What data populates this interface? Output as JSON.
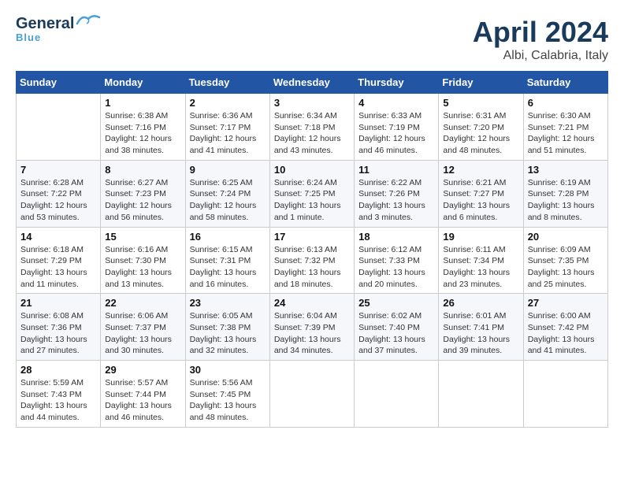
{
  "header": {
    "logo_general": "General",
    "logo_blue": "Blue",
    "month": "April 2024",
    "location": "Albi, Calabria, Italy"
  },
  "days_of_week": [
    "Sunday",
    "Monday",
    "Tuesday",
    "Wednesday",
    "Thursday",
    "Friday",
    "Saturday"
  ],
  "weeks": [
    [
      {
        "day": "",
        "info": ""
      },
      {
        "day": "1",
        "info": "Sunrise: 6:38 AM\nSunset: 7:16 PM\nDaylight: 12 hours\nand 38 minutes."
      },
      {
        "day": "2",
        "info": "Sunrise: 6:36 AM\nSunset: 7:17 PM\nDaylight: 12 hours\nand 41 minutes."
      },
      {
        "day": "3",
        "info": "Sunrise: 6:34 AM\nSunset: 7:18 PM\nDaylight: 12 hours\nand 43 minutes."
      },
      {
        "day": "4",
        "info": "Sunrise: 6:33 AM\nSunset: 7:19 PM\nDaylight: 12 hours\nand 46 minutes."
      },
      {
        "day": "5",
        "info": "Sunrise: 6:31 AM\nSunset: 7:20 PM\nDaylight: 12 hours\nand 48 minutes."
      },
      {
        "day": "6",
        "info": "Sunrise: 6:30 AM\nSunset: 7:21 PM\nDaylight: 12 hours\nand 51 minutes."
      }
    ],
    [
      {
        "day": "7",
        "info": "Sunrise: 6:28 AM\nSunset: 7:22 PM\nDaylight: 12 hours\nand 53 minutes."
      },
      {
        "day": "8",
        "info": "Sunrise: 6:27 AM\nSunset: 7:23 PM\nDaylight: 12 hours\nand 56 minutes."
      },
      {
        "day": "9",
        "info": "Sunrise: 6:25 AM\nSunset: 7:24 PM\nDaylight: 12 hours\nand 58 minutes."
      },
      {
        "day": "10",
        "info": "Sunrise: 6:24 AM\nSunset: 7:25 PM\nDaylight: 13 hours\nand 1 minute."
      },
      {
        "day": "11",
        "info": "Sunrise: 6:22 AM\nSunset: 7:26 PM\nDaylight: 13 hours\nand 3 minutes."
      },
      {
        "day": "12",
        "info": "Sunrise: 6:21 AM\nSunset: 7:27 PM\nDaylight: 13 hours\nand 6 minutes."
      },
      {
        "day": "13",
        "info": "Sunrise: 6:19 AM\nSunset: 7:28 PM\nDaylight: 13 hours\nand 8 minutes."
      }
    ],
    [
      {
        "day": "14",
        "info": "Sunrise: 6:18 AM\nSunset: 7:29 PM\nDaylight: 13 hours\nand 11 minutes."
      },
      {
        "day": "15",
        "info": "Sunrise: 6:16 AM\nSunset: 7:30 PM\nDaylight: 13 hours\nand 13 minutes."
      },
      {
        "day": "16",
        "info": "Sunrise: 6:15 AM\nSunset: 7:31 PM\nDaylight: 13 hours\nand 16 minutes."
      },
      {
        "day": "17",
        "info": "Sunrise: 6:13 AM\nSunset: 7:32 PM\nDaylight: 13 hours\nand 18 minutes."
      },
      {
        "day": "18",
        "info": "Sunrise: 6:12 AM\nSunset: 7:33 PM\nDaylight: 13 hours\nand 20 minutes."
      },
      {
        "day": "19",
        "info": "Sunrise: 6:11 AM\nSunset: 7:34 PM\nDaylight: 13 hours\nand 23 minutes."
      },
      {
        "day": "20",
        "info": "Sunrise: 6:09 AM\nSunset: 7:35 PM\nDaylight: 13 hours\nand 25 minutes."
      }
    ],
    [
      {
        "day": "21",
        "info": "Sunrise: 6:08 AM\nSunset: 7:36 PM\nDaylight: 13 hours\nand 27 minutes."
      },
      {
        "day": "22",
        "info": "Sunrise: 6:06 AM\nSunset: 7:37 PM\nDaylight: 13 hours\nand 30 minutes."
      },
      {
        "day": "23",
        "info": "Sunrise: 6:05 AM\nSunset: 7:38 PM\nDaylight: 13 hours\nand 32 minutes."
      },
      {
        "day": "24",
        "info": "Sunrise: 6:04 AM\nSunset: 7:39 PM\nDaylight: 13 hours\nand 34 minutes."
      },
      {
        "day": "25",
        "info": "Sunrise: 6:02 AM\nSunset: 7:40 PM\nDaylight: 13 hours\nand 37 minutes."
      },
      {
        "day": "26",
        "info": "Sunrise: 6:01 AM\nSunset: 7:41 PM\nDaylight: 13 hours\nand 39 minutes."
      },
      {
        "day": "27",
        "info": "Sunrise: 6:00 AM\nSunset: 7:42 PM\nDaylight: 13 hours\nand 41 minutes."
      }
    ],
    [
      {
        "day": "28",
        "info": "Sunrise: 5:59 AM\nSunset: 7:43 PM\nDaylight: 13 hours\nand 44 minutes."
      },
      {
        "day": "29",
        "info": "Sunrise: 5:57 AM\nSunset: 7:44 PM\nDaylight: 13 hours\nand 46 minutes."
      },
      {
        "day": "30",
        "info": "Sunrise: 5:56 AM\nSunset: 7:45 PM\nDaylight: 13 hours\nand 48 minutes."
      },
      {
        "day": "",
        "info": ""
      },
      {
        "day": "",
        "info": ""
      },
      {
        "day": "",
        "info": ""
      },
      {
        "day": "",
        "info": ""
      }
    ]
  ]
}
